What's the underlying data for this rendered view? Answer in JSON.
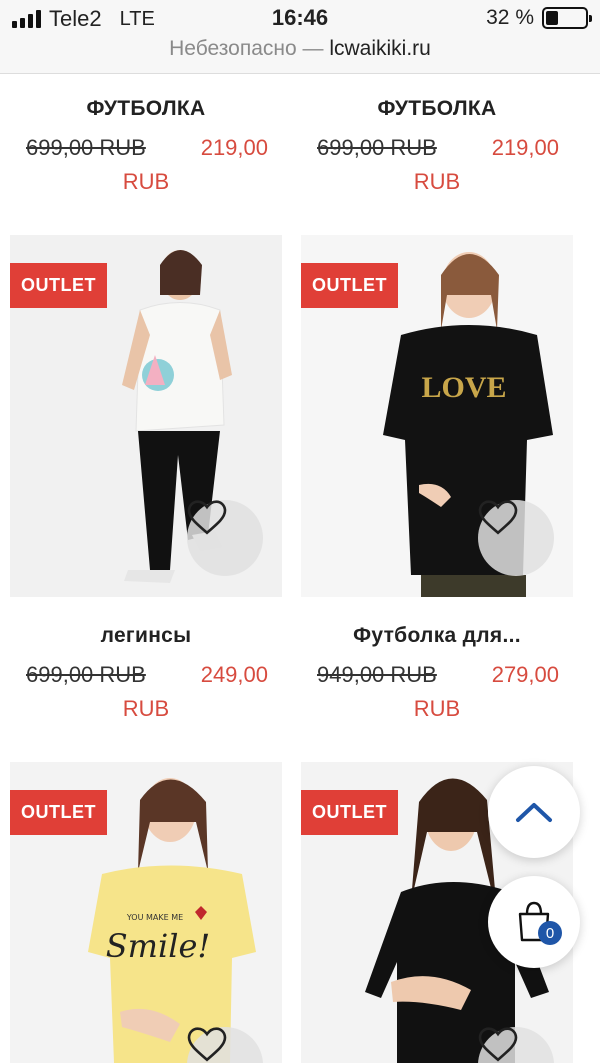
{
  "status_bar": {
    "carrier": "Tele2",
    "network": "LTE",
    "time": "16:46",
    "battery_text": "32 %",
    "battery_level": 0.32
  },
  "address_bar": {
    "insecure_label": "Небезопасно —",
    "domain": "lcwaikiki.ru"
  },
  "products": [
    {
      "name": "ФУТБОЛКА",
      "old_price": "699,00 RUB",
      "new_price": "219,00",
      "currency": "RUB"
    },
    {
      "name": "ФУТБОЛКА",
      "old_price": "699,00 RUB",
      "new_price": "219,00",
      "currency": "RUB"
    },
    {
      "name": "легинсы",
      "old_price": "699,00 RUB",
      "new_price": "249,00",
      "currency": "RUB",
      "badge": "OUTLET",
      "image_icon": "photo-woman-white-tee-leggings"
    },
    {
      "name": "Футболка для...",
      "old_price": "949,00 RUB",
      "new_price": "279,00",
      "currency": "RUB",
      "badge": "OUTLET",
      "image_icon": "photo-woman-black-love-tee",
      "image_text": "LOVE"
    },
    {
      "badge": "OUTLET",
      "image_icon": "photo-woman-yellow-smile-tee",
      "image_text": "Smile!",
      "image_small_text": "YOU MAKE ME"
    },
    {
      "badge": "OUTLET",
      "image_icon": "photo-woman-black-longsleeve"
    }
  ],
  "cart": {
    "count": "0",
    "icon": "shopping-bag-icon"
  },
  "scroll_top": {
    "icon": "chevron-up-icon"
  },
  "colors": {
    "accent_red": "#e03f37",
    "price_red": "#d74b3f",
    "badge_blue": "#1f56a8"
  }
}
